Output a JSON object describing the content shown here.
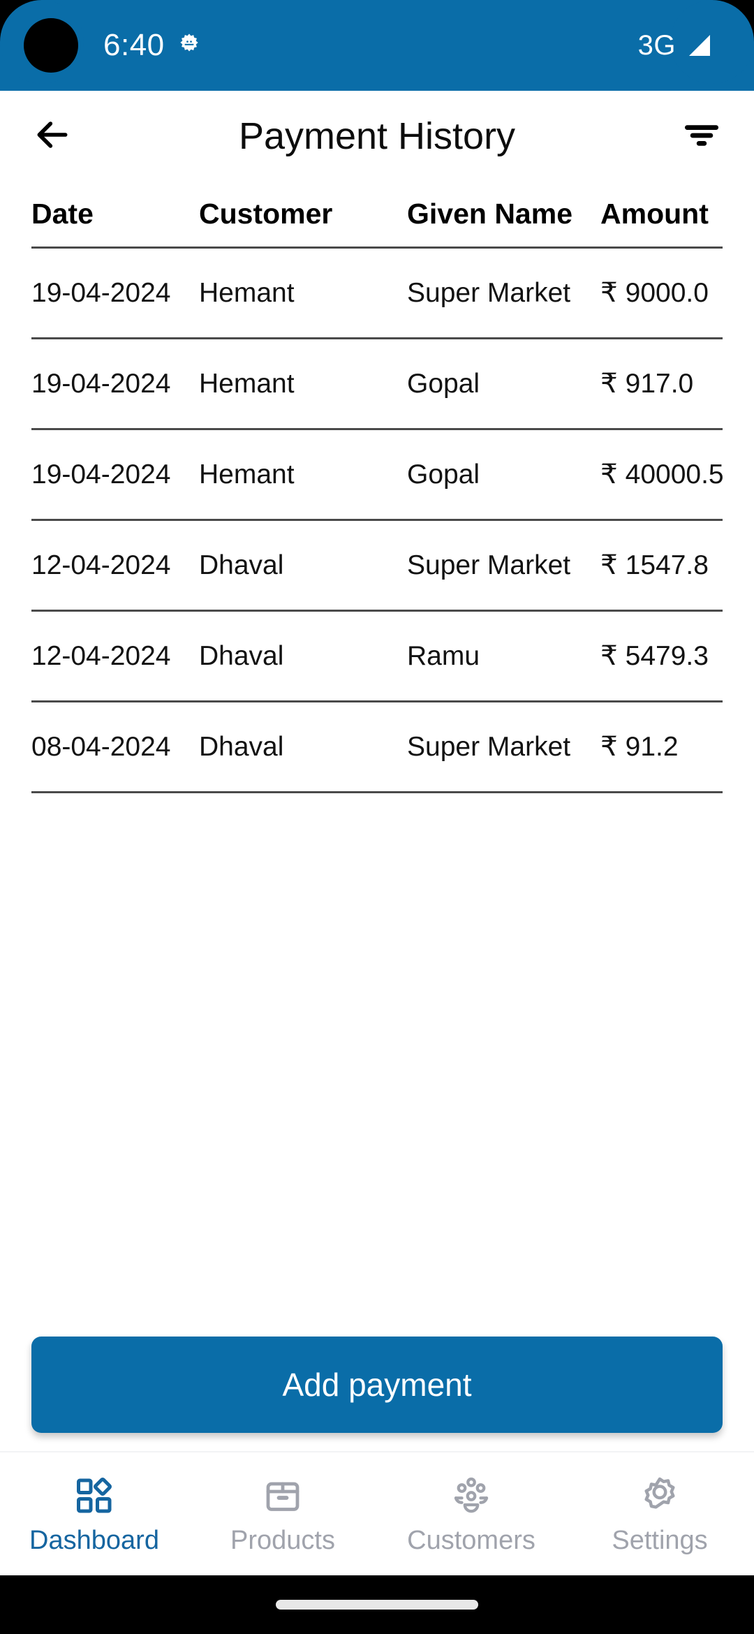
{
  "status_bar": {
    "time": "6:40",
    "debug_icon": "gear-icon",
    "network_type": "3G",
    "signal_icon": "signal-triangle-icon",
    "background_color": "#0a6da8"
  },
  "app_bar": {
    "back_icon": "arrow-left-icon",
    "title": "Payment History",
    "filter_icon": "filter-icon"
  },
  "table": {
    "columns": [
      "Date",
      "Customer",
      "Given Name",
      "Amount"
    ],
    "rows": [
      {
        "date": "19-04-2024",
        "customer": "Hemant",
        "given_name": "Super Market",
        "amount": "₹ 9000.0"
      },
      {
        "date": "19-04-2024",
        "customer": "Hemant",
        "given_name": "Gopal",
        "amount": "₹ 917.0"
      },
      {
        "date": "19-04-2024",
        "customer": "Hemant",
        "given_name": "Gopal",
        "amount": "₹ 40000.5"
      },
      {
        "date": "12-04-2024",
        "customer": "Dhaval",
        "given_name": "Super Market",
        "amount": "₹ 1547.8"
      },
      {
        "date": "12-04-2024",
        "customer": "Dhaval",
        "given_name": "Ramu",
        "amount": "₹ 5479.3"
      },
      {
        "date": "08-04-2024",
        "customer": "Dhaval",
        "given_name": "Super Market",
        "amount": "₹ 91.2"
      }
    ]
  },
  "cta": {
    "label": "Add payment",
    "color": "#0a6da8"
  },
  "bottom_nav": {
    "active_color": "#1565a0",
    "inactive_color": "#a0a3ac",
    "items": [
      {
        "label": "Dashboard",
        "icon": "dashboard-grid-icon",
        "active": true
      },
      {
        "label": "Products",
        "icon": "box-icon",
        "active": false
      },
      {
        "label": "Customers",
        "icon": "people-group-icon",
        "active": false
      },
      {
        "label": "Settings",
        "icon": "gear-icon",
        "active": false
      }
    ]
  }
}
